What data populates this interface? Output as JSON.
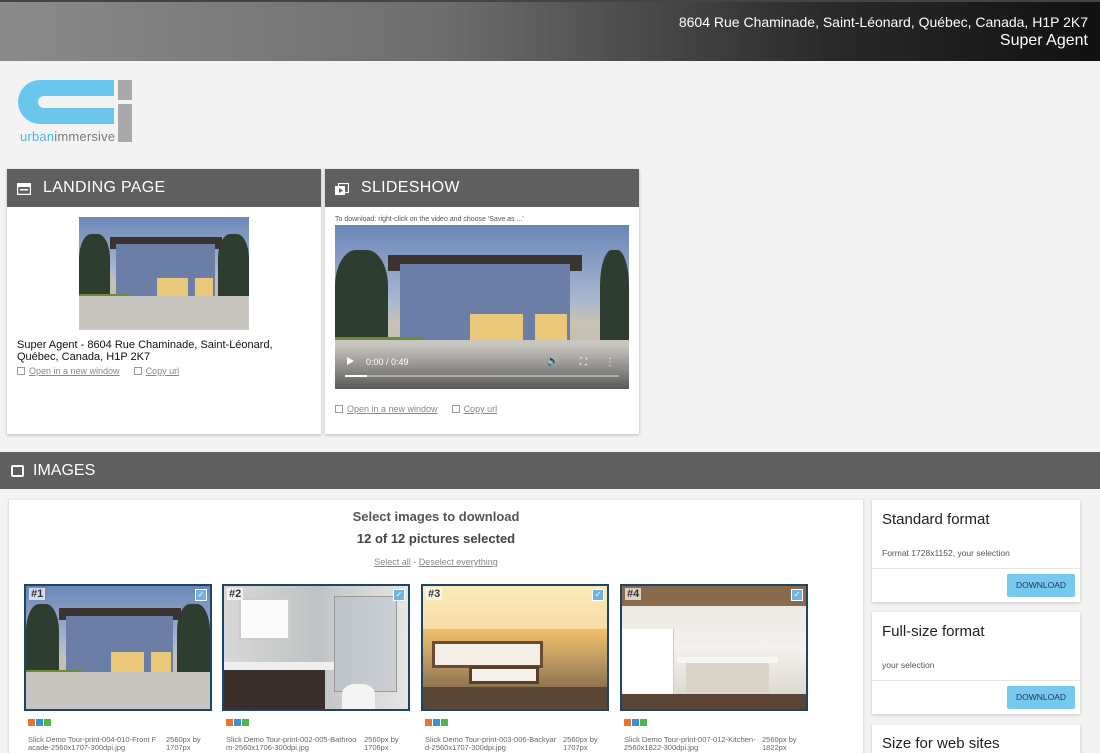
{
  "header": {
    "address": "8604 Rue Chaminade, Saint-Léonard, Québec, Canada, H1P 2K7",
    "agent": "Super Agent"
  },
  "logo": {
    "brand_part1": "urban",
    "brand_part2": "immersive"
  },
  "landing": {
    "title": "LANDING PAGE",
    "caption": "Super Agent - 8604 Rue Chaminade, Saint-Léonard, Québec, Canada, H1P 2K7",
    "open_link": "Open in a new window",
    "copy_link": "Copy url"
  },
  "slideshow": {
    "title": "SLIDESHOW",
    "note": "To download: right-click on the video and choose 'Save as ...'",
    "time": "0:00 / 0:49",
    "progress": 0.08,
    "open_link": "Open in a new window",
    "copy_link": "Copy url"
  },
  "images": {
    "section_title": "IMAGES",
    "select_title": "Select images to download",
    "selected_count": "12 of 12 pictures selected",
    "select_all": "Select all",
    "separator": "-",
    "deselect": "Deselect everything",
    "items": [
      {
        "num": "#1",
        "file": "Slick Demo Tour-print-004-010-Front Facade-2560x1707-300dpi.jpg",
        "size": "2560px by 1707px",
        "scene": "facade"
      },
      {
        "num": "#2",
        "file": "Slick Demo Tour-print-002-005-Bathroom-2560x1706-300dpi.jpg",
        "size": "2560px by 1706px",
        "scene": "bathroom"
      },
      {
        "num": "#3",
        "file": "Slick Demo Tour-print-003-006-Backyard-2560x1707-300dpi.jpg",
        "size": "2560px by 1707px",
        "scene": "backyard"
      },
      {
        "num": "#4",
        "file": "Slick Demo Tour-print-007-012-Kitchen-2560x1822-300dpi.jpg",
        "size": "2560px by 1822px",
        "scene": "kitchen"
      }
    ],
    "tag_colors": [
      "#e8742e",
      "#3d8fd6",
      "#4bb84b"
    ]
  },
  "formats": [
    {
      "title": "Standard format",
      "desc": "Format 1728x1152, your selection",
      "button": "DOWNLOAD"
    },
    {
      "title": "Full-size format",
      "desc": "your selection",
      "button": "DOWNLOAD"
    },
    {
      "title": "Size for web sites",
      "desc": "",
      "button": ""
    }
  ],
  "icons": {
    "landing": "web-page-icon",
    "slideshow": "slideshow-icon",
    "images": "image-icon",
    "open": "external-link-icon",
    "copy": "copy-icon"
  }
}
